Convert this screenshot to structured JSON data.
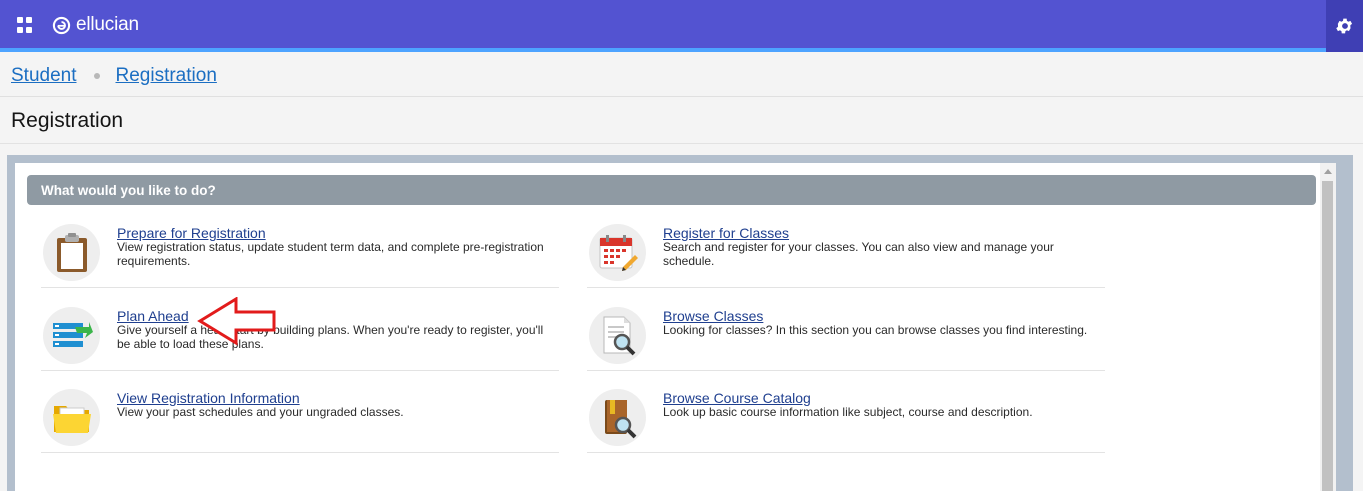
{
  "header": {
    "brand": "ellucian",
    "accent": "#5353d1"
  },
  "breadcrumb": {
    "items": [
      "Student",
      "Registration"
    ]
  },
  "page": {
    "title": "Registration"
  },
  "panel": {
    "heading": "What would you like to do?"
  },
  "items": [
    {
      "title": "Prepare for Registration",
      "desc": "View registration status, update student term data, and complete pre-registration requirements.",
      "icon": "clipboard-icon"
    },
    {
      "title": "Register for Classes",
      "desc": "Search and register for your classes. You can also view and manage your schedule.",
      "icon": "calendar-icon"
    },
    {
      "title": "Plan Ahead",
      "desc": "Give yourself a head start by building plans. When you're ready to register, you'll be able to load these plans.",
      "icon": "plan-list-icon"
    },
    {
      "title": "Browse Classes",
      "desc": "Looking for classes? In this section you can browse classes you find interesting.",
      "icon": "document-search-icon"
    },
    {
      "title": "View Registration Information",
      "desc": "View your past schedules and your ungraded classes.",
      "icon": "folder-icon"
    },
    {
      "title": "Browse Course Catalog",
      "desc": "Look up basic course information like subject, course and description.",
      "icon": "book-search-icon"
    }
  ]
}
